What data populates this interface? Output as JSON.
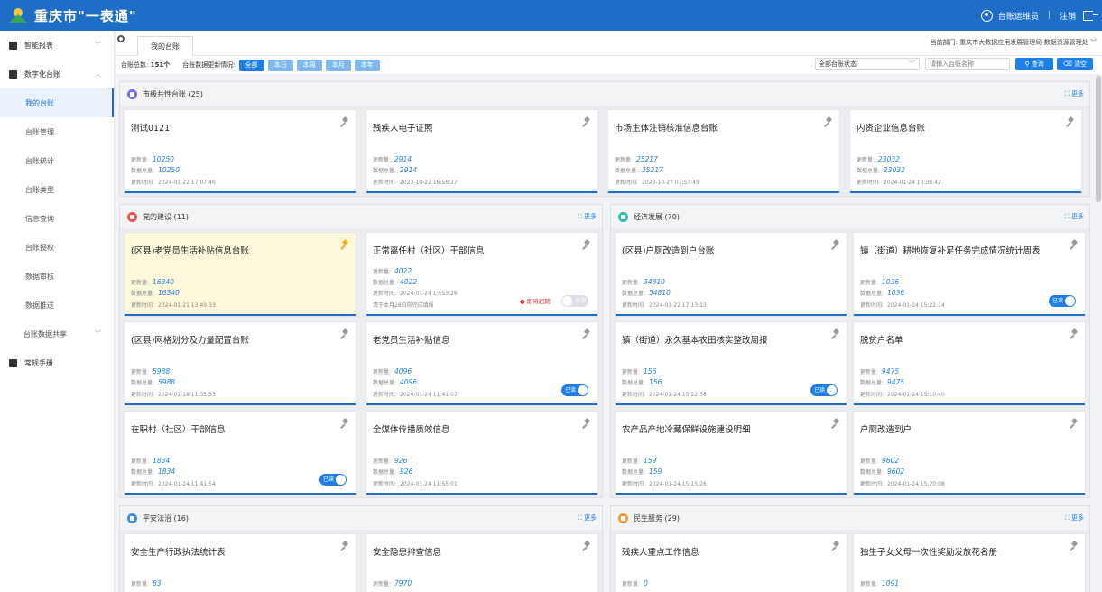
{
  "app": {
    "title": "重庆市\"一表通\""
  },
  "topbar": {
    "username": "台账运维员",
    "separator": "|",
    "logout": "注销"
  },
  "sidebar": {
    "groups": [
      {
        "label": "智能报表"
      },
      {
        "label": "数字化台账"
      },
      {
        "label": "常规手册"
      }
    ],
    "items": [
      {
        "label": "我的台账"
      },
      {
        "label": "台账管理"
      },
      {
        "label": "台账统计"
      },
      {
        "label": "台账类型"
      },
      {
        "label": "信息查询"
      },
      {
        "label": "台账授权"
      },
      {
        "label": "数据审核"
      },
      {
        "label": "数据推送"
      },
      {
        "label": "台账数据共享"
      }
    ]
  },
  "tabs": [
    {
      "label": "我的台账"
    }
  ],
  "department": "当前部门: 重庆市大数据应用发展管理局-数据资源管理处",
  "toolbar": {
    "count_label": "台账总数:",
    "count_value": "151个",
    "update_label": "台账数据更新情况:",
    "filters": [
      "全部",
      "本日",
      "本周",
      "本月",
      "本年"
    ],
    "status_select": "全部台账状态",
    "search_placeholder": "请输入台账名称",
    "query_label": "查询",
    "clear_label": "清空"
  },
  "labels": {
    "updated": "更新量:",
    "total": "数据总量:",
    "time": "更新时间:",
    "more": "更多",
    "read": "已读",
    "unread": "未读"
  },
  "sections": [
    {
      "title": "市级共性台账 (25)",
      "color": "#6f6fe0",
      "cards": [
        {
          "title": "测试0121",
          "updated": "10250",
          "total": "10250",
          "time": "2024-01-22 17:07:46"
        },
        {
          "title": "残疾人电子证照",
          "updated": "2914",
          "total": "2914",
          "time": "2023-10-22 16:58:27"
        },
        {
          "title": "市场主体注销核准信息台账",
          "updated": "25217",
          "total": "25217",
          "time": "2023-10-27 07:57:45"
        },
        {
          "title": "内资企业信息台账",
          "updated": "23032",
          "total": "23032",
          "time": "2024-01-24 10:38:42"
        }
      ]
    },
    {
      "title": "党的建设 (11)",
      "color": "#e8504e",
      "cards": [
        {
          "title": "(区县)老党员生活补贴信息台账",
          "updated": "16340",
          "total": "16340",
          "time": "2024-01-21 13:49:33"
        },
        {
          "title": "正常离任村（社区）干部信息",
          "updated": "4022",
          "total": "4022",
          "time": "2024-01-24 17:53:26",
          "remind": "请于本月28日前完成填报",
          "warn": "即将超期"
        },
        {
          "title": "(区县)网格划分及力量配置台账",
          "updated": "5988",
          "total": "5988",
          "time": "2024-01-18 11:35:33"
        },
        {
          "title": "老党员生活补贴信息",
          "updated": "4096",
          "total": "4096",
          "time": "2024-01-24 11:41:07"
        },
        {
          "title": "在职村（社区）干部信息",
          "updated": "1834",
          "total": "1834",
          "time": "2024-01-24 11:41:54"
        },
        {
          "title": "全媒体传播质效信息",
          "updated": "926",
          "total": "926",
          "time": "2024-01-24 11:55:01"
        }
      ]
    },
    {
      "title": "经济发展 (70)",
      "color": "#2bbfa8",
      "cards": [
        {
          "title": "(区县)户厕改造到户台账",
          "updated": "34810",
          "total": "34810",
          "time": "2024-01-22 17:13:13"
        },
        {
          "title": "镇（街道）耕地恢复补足任务完成情况统计周表",
          "updated": "1036",
          "total": "1036",
          "time": "2024-01-24 15:22:14"
        },
        {
          "title": "镇（街道）永久基本农田核实整改周报",
          "updated": "156",
          "total": "156",
          "time": "2024-01-24 15:22:38"
        },
        {
          "title": "脱贫户名单",
          "updated": "9475",
          "total": "9475",
          "time": "2024-01-24 15:10:40"
        },
        {
          "title": "农产品产地冷藏保鲜设施建设明细",
          "updated": "159",
          "total": "159",
          "time": "2024-01-24 15:15:26"
        },
        {
          "title": "户厕改造到户",
          "updated": "9602",
          "total": "9602",
          "time": "2024-01-24 15:20:08"
        }
      ]
    },
    {
      "title": "平安法治 (16)",
      "color": "#3a8ee6",
      "cards": [
        {
          "title": "安全生产行政执法统计表",
          "updated": "83"
        },
        {
          "title": "安全隐患排查信息",
          "updated": "7970"
        }
      ]
    },
    {
      "title": "民生服务 (29)",
      "color": "#f29a3a",
      "cards": [
        {
          "title": "残疾人重点工作信息",
          "updated": "0"
        },
        {
          "title": "独生子女父母一次性奖励发放花名册",
          "updated": "1091"
        }
      ]
    }
  ]
}
